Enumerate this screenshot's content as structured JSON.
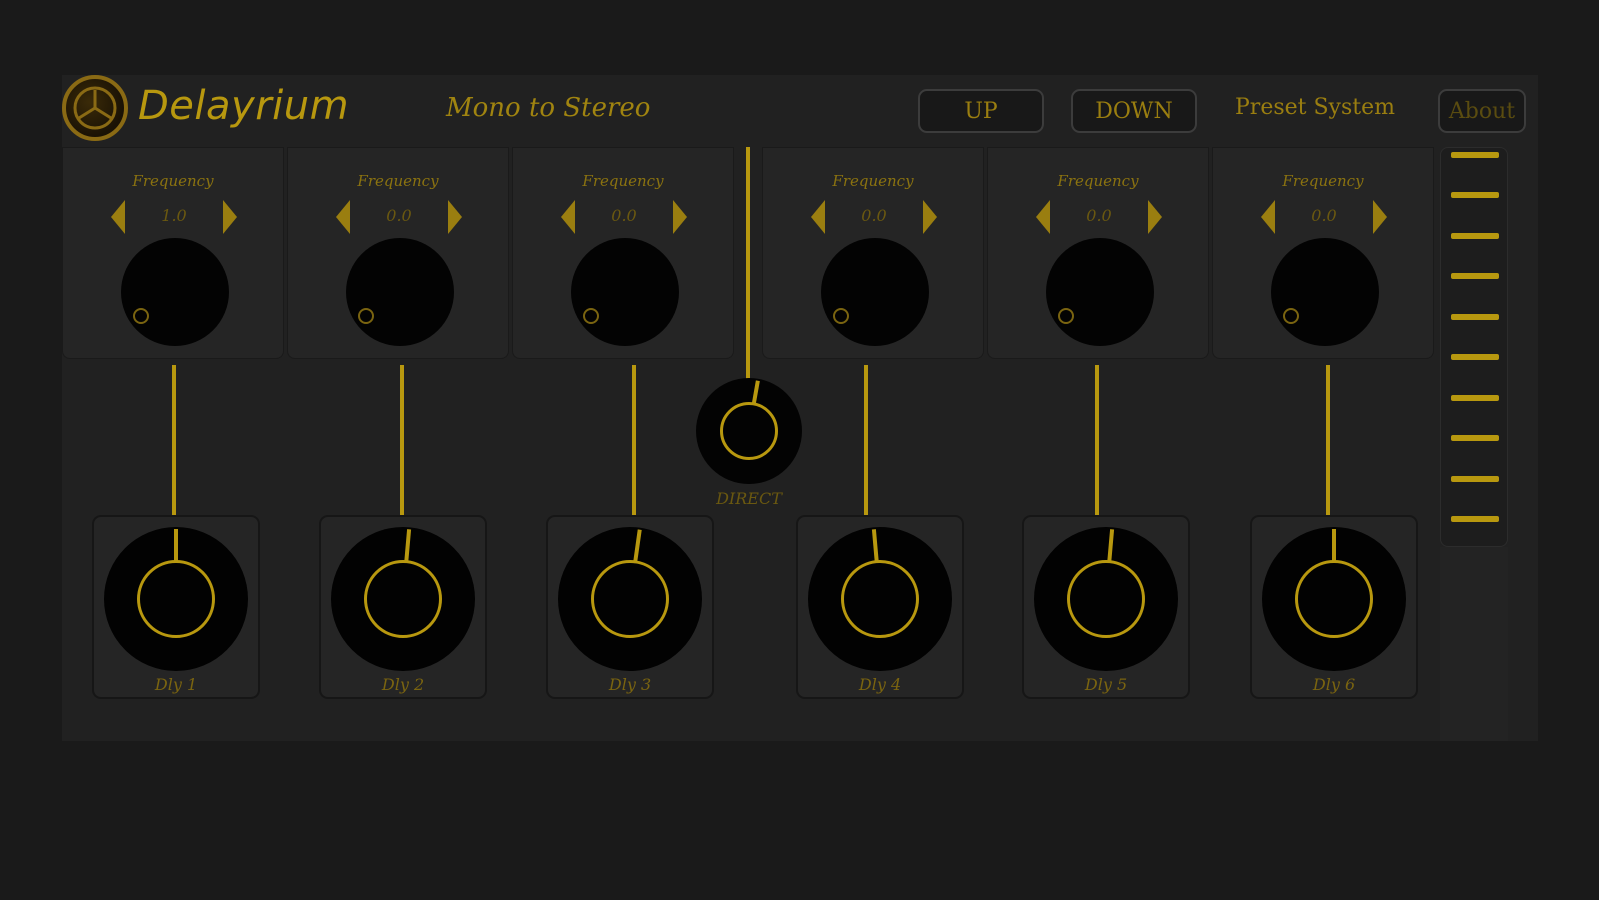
{
  "header": {
    "brand": "Delayrium",
    "mode": "Mono to Stereo",
    "up_label": "UP",
    "down_label": "DOWN",
    "preset_label": "Preset System",
    "about_label": "About"
  },
  "freq_label": "Frequency",
  "channels": [
    {
      "frequency": "1.0",
      "delay_label": "Dly 1"
    },
    {
      "frequency": "0.0",
      "delay_label": "Dly 2"
    },
    {
      "frequency": "0.0",
      "delay_label": "Dly 3"
    },
    {
      "frequency": "0.0",
      "delay_label": "Dly 4"
    },
    {
      "frequency": "0.0",
      "delay_label": "Dly 5"
    },
    {
      "frequency": "0.0",
      "delay_label": "Dly 6"
    }
  ],
  "direct_label": "DIRECT",
  "colors": {
    "accent": "#b8980f",
    "background": "#1a1a1a",
    "panel": "#252525"
  },
  "icons": {
    "logo": "triskelion-logo-icon",
    "left": "arrow-left-icon",
    "right": "arrow-right-icon"
  }
}
